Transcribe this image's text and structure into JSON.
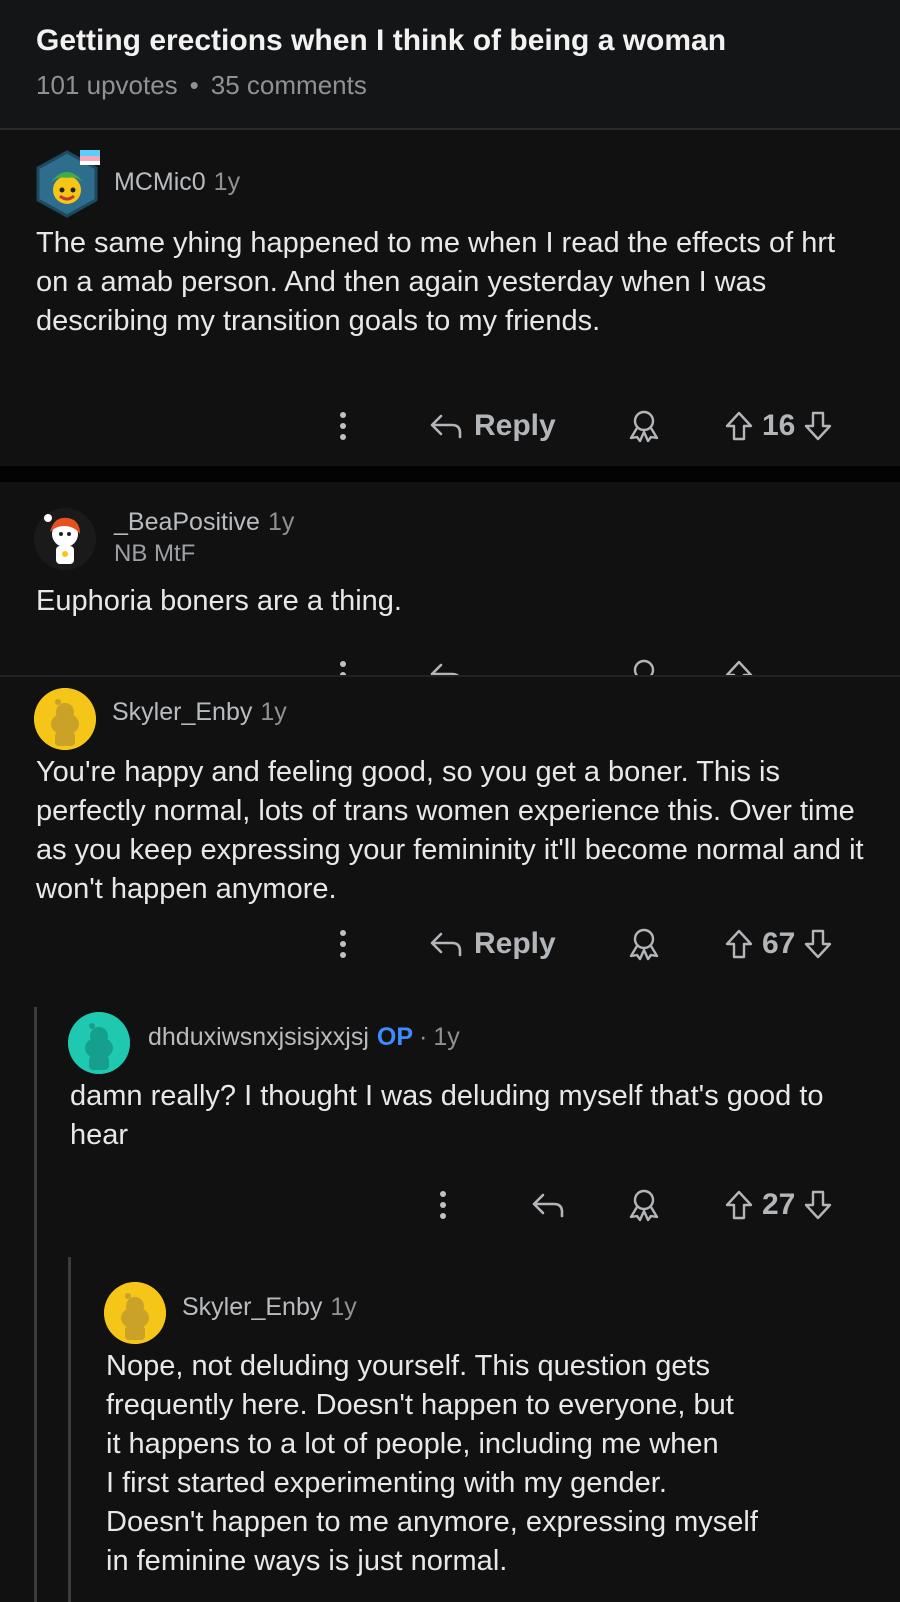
{
  "post": {
    "title": "Getting erections when I think of being a woman",
    "upvotes": "101 upvotes",
    "comments": "35 comments"
  },
  "comments": [
    {
      "username": "MCMic0",
      "age": "1y",
      "text": "The same yhing happened to me when I read the effects of hrt on a amab person. And then again yesterday when I was describing my transition goals to my friends.",
      "reply_label": "Reply",
      "votes": "16"
    },
    {
      "username": "_BeaPositive",
      "age": "1y",
      "flair": "NB MtF",
      "text": "Euphoria boners are a thing."
    },
    {
      "username": "Skyler_Enby",
      "age": "1y",
      "text": "You're happy and feeling good, so you get a boner. This is perfectly normal, lots of trans women experience this. Over time as you keep expressing your femininity it'll become normal and it won't happen anymore.",
      "reply_label": "Reply",
      "votes": "67"
    },
    {
      "username": "dhduxiwsnxjsisjxxjsj",
      "op_badge": "OP",
      "separator": "·",
      "age": "1y",
      "text": "damn really? I thought I was deluding myself that's good to hear",
      "votes": "27"
    },
    {
      "username": "Skyler_Enby",
      "age": "1y",
      "text_lines": [
        "Nope, not deluding yourself. This question gets",
        "frequently here. Doesn't happen to everyone, but",
        "it happens to a lot of people, including me when",
        "I first started experimenting with my gender.",
        "Doesn't happen to me anymore, expressing myself",
        "in feminine ways is just normal."
      ]
    }
  ],
  "icons": {
    "more": "kebab-icon",
    "reply": "reply-arrow-icon",
    "award": "award-icon",
    "upvote": "upvote-arrow-icon",
    "downvote": "downvote-arrow-icon"
  },
  "colors": {
    "background": "#0b0b0b",
    "op_badge": "#3d8bfd",
    "snoo_yellow": "#f5c518",
    "snoo_teal": "#1ec9b0"
  }
}
